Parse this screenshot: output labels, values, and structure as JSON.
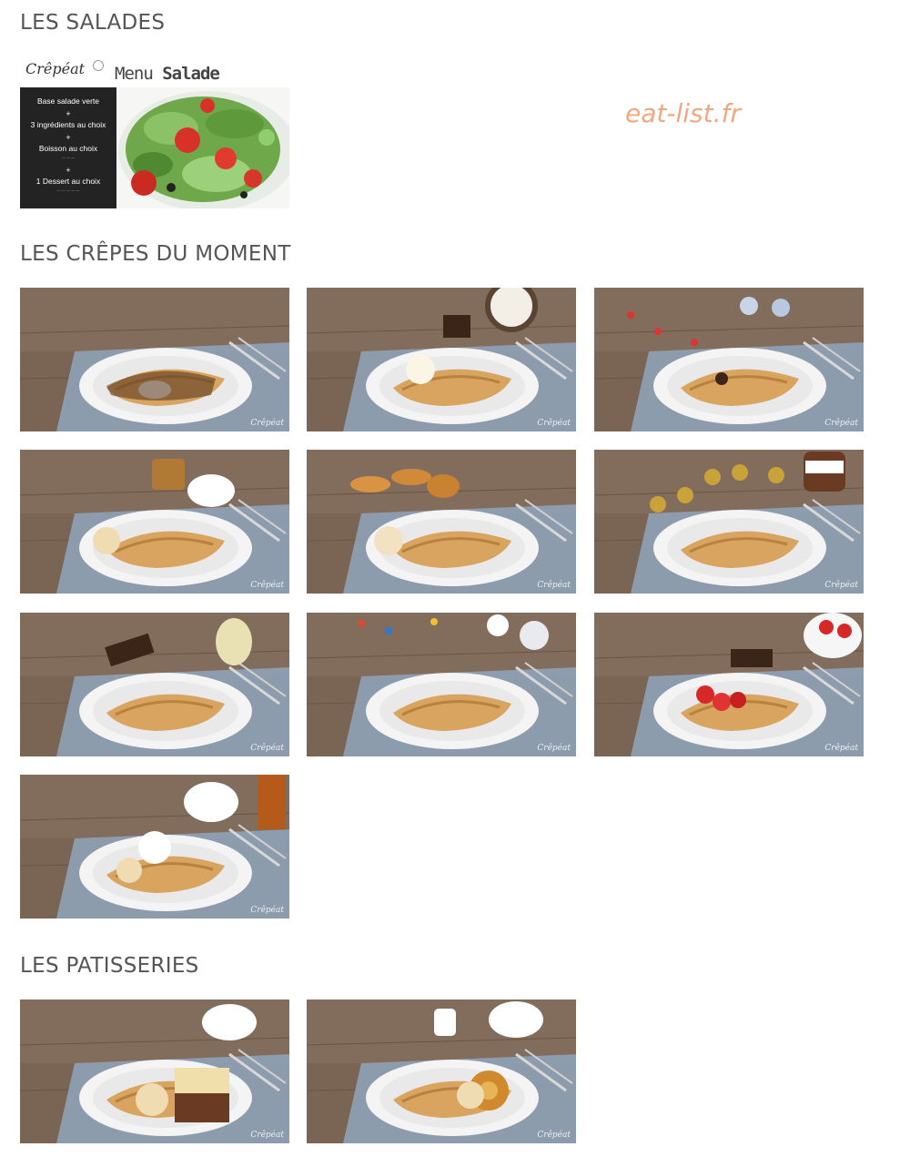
{
  "site_watermark": "eat-list.fr",
  "sections": {
    "salades": {
      "title": "LES SALADES"
    },
    "crepes": {
      "title": "LES CRÊPES DU MOMENT"
    },
    "patisseries": {
      "title": "LES PATISSERIES"
    }
  },
  "salad_menu": {
    "brand": "Crêpéat",
    "menu_word": "Menu",
    "menu_bold": "Salade",
    "lines": [
      "Base salade verte",
      "+",
      "3 ingrédients au choix",
      "+",
      "Boisson au choix",
      "+",
      "1 Dessert au choix"
    ]
  },
  "crepe_photos": [
    {
      "subject": "crepe-chocolate-whipped-cream",
      "brand": "Crêpéat"
    },
    {
      "subject": "crepe-coconut-ice-cream",
      "brand": "Crêpéat"
    },
    {
      "subject": "crepe-kinder",
      "brand": "Crêpéat"
    },
    {
      "subject": "crepe-salted-caramel-tea",
      "brand": "Crêpéat"
    },
    {
      "subject": "crepe-madeleines",
      "brand": "Crêpéat"
    },
    {
      "subject": "crepe-ferrero-nutella",
      "brand": "Crêpéat"
    },
    {
      "subject": "crepe-pear-chocolate",
      "brand": "Crêpéat"
    },
    {
      "subject": "crepe-mms",
      "brand": "Crêpéat"
    },
    {
      "subject": "crepe-strawberry",
      "brand": "Crêpéat"
    },
    {
      "subject": "crepe-maple-syrup",
      "brand": "Crêpéat"
    }
  ],
  "pastry_photos": [
    {
      "subject": "cheesecake-brownie",
      "brand": "Crêpéat"
    },
    {
      "subject": "pineapple-cake",
      "brand": "Crêpéat"
    }
  ],
  "colors": {
    "title_text": "#555555",
    "watermark": "#f0a882",
    "wood": "#7a6454",
    "napkin": "#8fa6bd",
    "plate": "#f4f4f4",
    "crepe": "#d9a45f"
  }
}
